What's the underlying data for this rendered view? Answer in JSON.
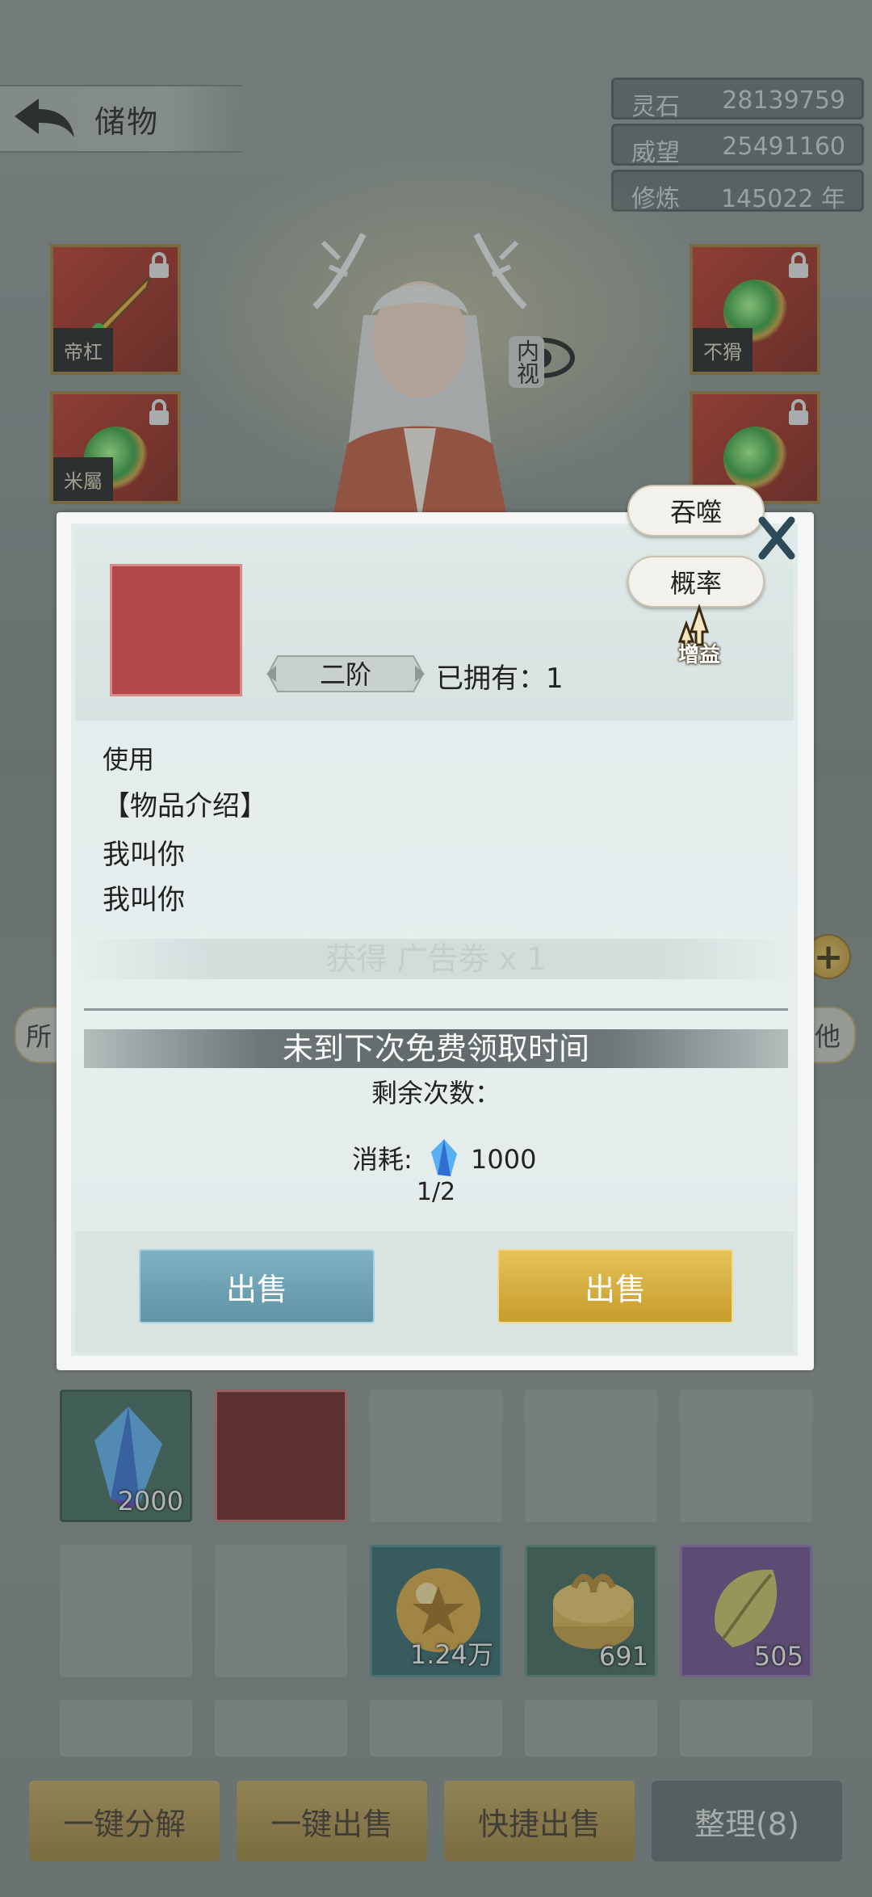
{
  "header": {
    "title": "储物",
    "back_icon": "back-arrow-icon"
  },
  "resources": [
    {
      "label": "灵石",
      "value": "28139759"
    },
    {
      "label": "威望",
      "value": "25491160"
    },
    {
      "label": "修炼",
      "value": "145022 年"
    }
  ],
  "equipment": {
    "left": [
      {
        "seal": "帝杠",
        "icon": "sword-icon"
      },
      {
        "seal": "米屬",
        "icon": "helmet-icon"
      }
    ],
    "right": [
      {
        "seal": "不猾",
        "icon": "ring-icon"
      }
    ],
    "view_label": "内视"
  },
  "side_tabs": {
    "left": "所",
    "right": "他"
  },
  "modal": {
    "rank": "二阶",
    "owned": "已拥有：1",
    "use": "使用",
    "intro_heading": "【物品介绍】",
    "desc_lines": [
      "我叫你",
      "我叫你"
    ],
    "ad_reward": "获得 广告劵 x 1",
    "notice": "未到下次免费领取时间",
    "remaining": "剩余次数：",
    "cost_label": "消耗:",
    "cost_value": "1000",
    "fraction": "1/2",
    "sell_left": "出售",
    "sell_right": "出售",
    "devour": "吞噬",
    "probability": "概率",
    "boost": "增益",
    "item_color": "#b2484a"
  },
  "inventory": {
    "row1": [
      {
        "type": "crystal",
        "count": "2000"
      },
      {
        "type": "red",
        "count": ""
      },
      {
        "type": "empty",
        "count": ""
      },
      {
        "type": "empty",
        "count": ""
      },
      {
        "type": "empty",
        "count": ""
      }
    ],
    "row2": [
      {
        "type": "empty",
        "count": ""
      },
      {
        "type": "empty",
        "count": ""
      },
      {
        "type": "orb",
        "count": "1.24万"
      },
      {
        "type": "gift",
        "count": "691"
      },
      {
        "type": "leaf",
        "count": "505"
      }
    ]
  },
  "bottom_buttons": [
    "一键分解",
    "一键出售",
    "快捷出售",
    "整理(8)"
  ],
  "colors": {
    "accent_gold": "#c79d2c",
    "accent_blue": "#6fa3b4",
    "item_red": "#b2484a"
  }
}
